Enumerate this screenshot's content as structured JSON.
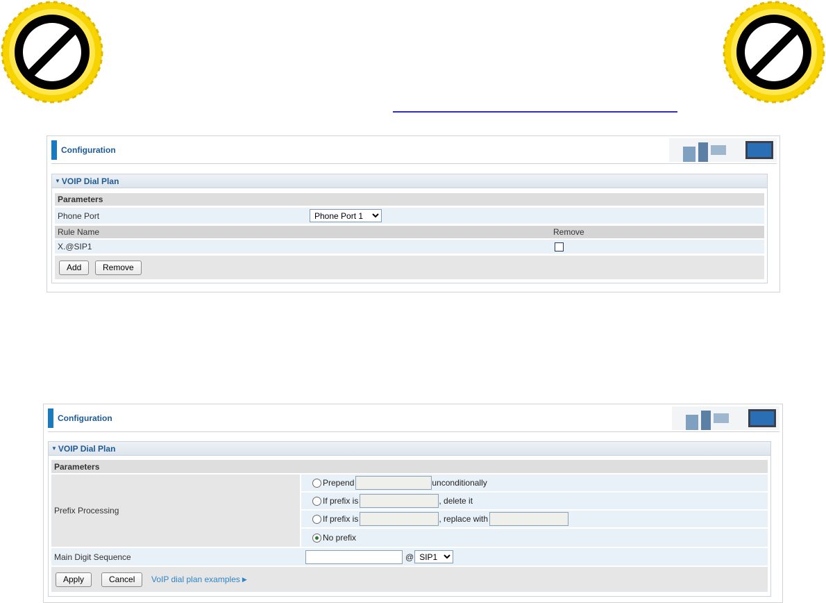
{
  "colors": {
    "accent": "#1a7ac0",
    "title": "#1d5a95",
    "badge_gear": "#f7d400",
    "link_line": "#2a2ad0"
  },
  "icons": {
    "badge": "prohibited-icon",
    "header_art": "office-scene-icon"
  },
  "panel1": {
    "title": "Configuration",
    "section_title": "VOIP Dial Plan",
    "parameters_label": "Parameters",
    "phone_port_label": "Phone Port",
    "phone_port_selected": "Phone Port 1",
    "table_headers": [
      "Rule Name",
      "Remove"
    ],
    "rules": [
      {
        "name": "X.@SIP1",
        "checked": false
      }
    ],
    "add_label": "Add",
    "remove_label": "Remove"
  },
  "panel2": {
    "title": "Configuration",
    "section_title": "VOIP Dial Plan",
    "parameters_label": "Parameters",
    "prefix_label": "Prefix Processing",
    "options": {
      "prepend": "Prepend",
      "unconditionally": "unconditionally",
      "if_prefix_is": "If prefix is",
      "delete_it": ", delete it",
      "replace_with": ", replace with",
      "no_prefix": "No prefix"
    },
    "selected_option": "No prefix",
    "main_digit_label": "Main Digit Sequence",
    "at": "@",
    "sip_selected": "SIP1",
    "apply_label": "Apply",
    "cancel_label": "Cancel",
    "examples_link": "VoIP dial plan examples"
  }
}
